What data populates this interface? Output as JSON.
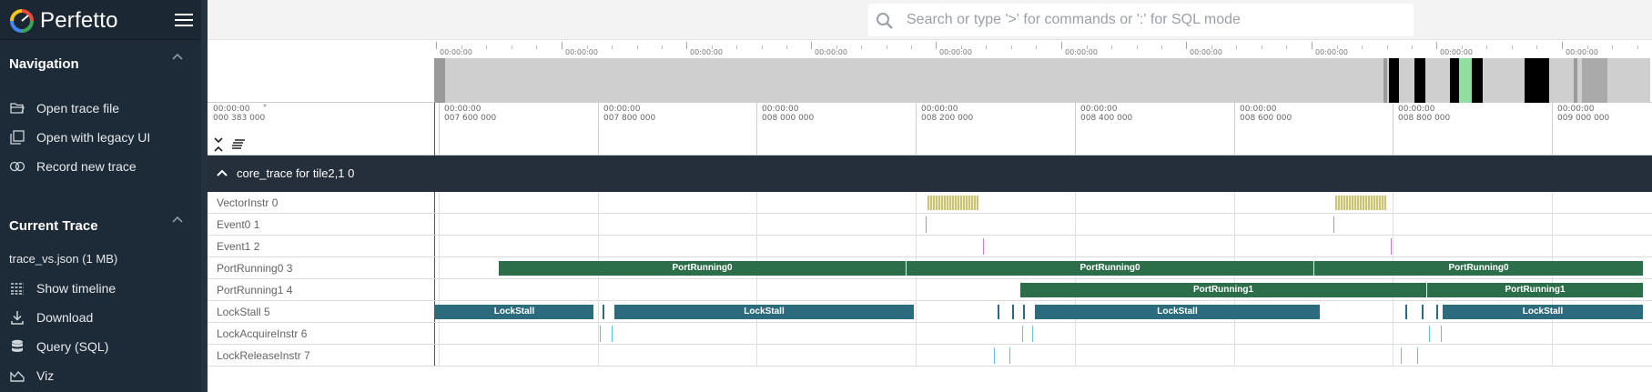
{
  "app": {
    "brand": "Perfetto",
    "colors": {
      "sidebar": "#1d2a38",
      "port_running": "#2d6e4a",
      "lock_stall": "#2c6b7d",
      "vector_instr": "#c9c47a",
      "event_mark": "#c97bd9",
      "lock_instr": "#5fc4d8"
    }
  },
  "search": {
    "placeholder": "Search or type '>' for commands or ':' for SQL mode"
  },
  "sidebar": {
    "navigation_title": "Navigation",
    "nav_items": [
      {
        "label": "Open trace file",
        "icon": "folder-open-icon"
      },
      {
        "label": "Open with legacy UI",
        "icon": "filter-none-icon"
      },
      {
        "label": "Record new trace",
        "icon": "record-icon"
      }
    ],
    "current_trace_title": "Current Trace",
    "trace_file": "trace_vs.json (1 MB)",
    "trace_items": [
      {
        "label": "Show timeline",
        "icon": "timeline-icon"
      },
      {
        "label": "Download",
        "icon": "download-icon"
      },
      {
        "label": "Query (SQL)",
        "icon": "database-icon"
      },
      {
        "label": "Viz",
        "icon": "area-chart-icon"
      }
    ]
  },
  "overview": {
    "tick_labels": [
      "00:00:00",
      "00:00:00",
      "00:00:00",
      "00:00:00",
      "00:00:00",
      "00:00:00",
      "00:00:00",
      "00:00:00",
      "00:00:00",
      "00:00:00"
    ]
  },
  "timeaxis": {
    "origin": [
      "00:00:00",
      "000 383 000"
    ],
    "ticks": [
      [
        "00:00:00",
        "007 600 000"
      ],
      [
        "00:00:00",
        "007 800 000"
      ],
      [
        "00:00:00",
        "008 000 000"
      ],
      [
        "00:00:00",
        "008 200 000"
      ],
      [
        "00:00:00",
        "008 400 000"
      ],
      [
        "00:00:00",
        "008 600 000"
      ],
      [
        "00:00:00",
        "008 800 000"
      ],
      [
        "00:00:00",
        "009 000 000"
      ]
    ]
  },
  "group": {
    "title": "core_trace for tile2,1 0"
  },
  "tracks": [
    {
      "name": "VectorInstr 0"
    },
    {
      "name": "Event0 1"
    },
    {
      "name": "Event1 2"
    },
    {
      "name": "PortRunning0 3",
      "slice_label": "PortRunning0"
    },
    {
      "name": "PortRunning1 4",
      "slice_label": "PortRunning1"
    },
    {
      "name": "LockStall 5",
      "slice_label": "LockStall"
    },
    {
      "name": "LockAcquireInstr 6"
    },
    {
      "name": "LockReleaseInstr 7"
    }
  ]
}
